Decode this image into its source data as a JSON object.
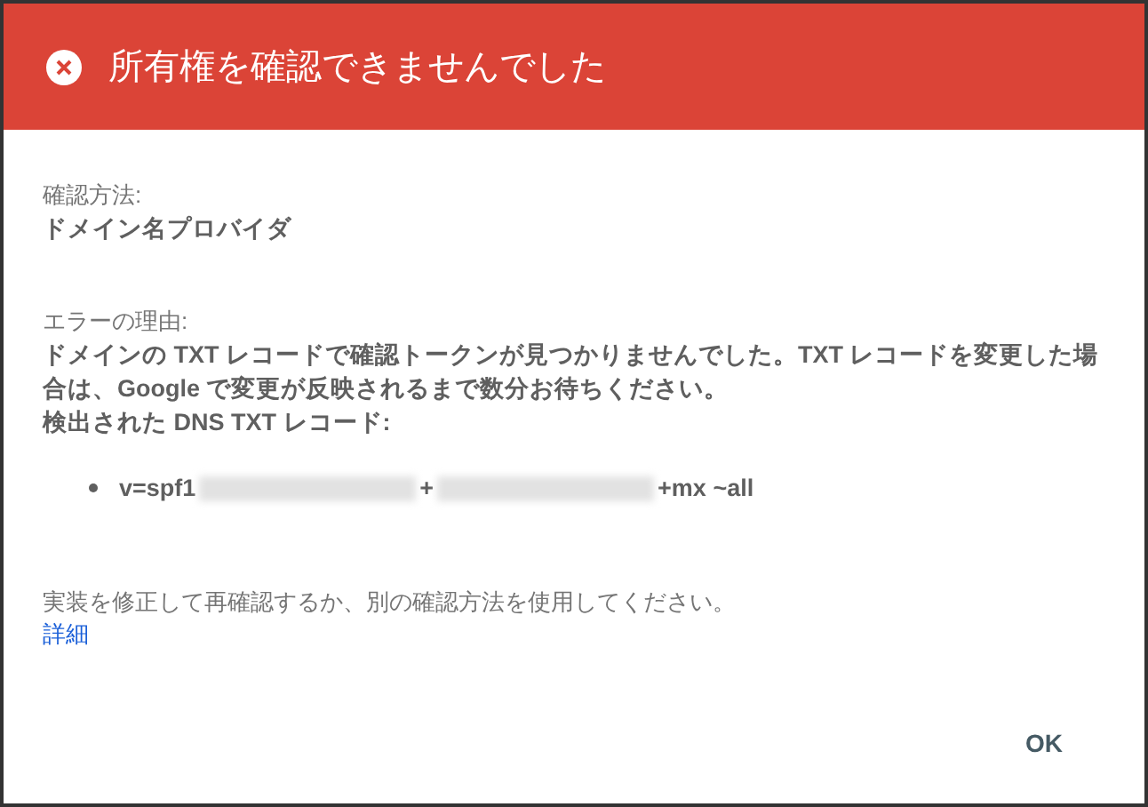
{
  "dialog": {
    "title": "所有権を確認できませんでした",
    "method": {
      "label": "確認方法:",
      "value": "ドメイン名プロバイダ"
    },
    "error": {
      "label": "エラーの理由:",
      "message": "ドメインの TXT レコードで確認トークンが見つかりませんでした。TXT レコードを変更した場合は、Google で変更が反映されるまで数分お待ちください。",
      "records_label": "検出された DNS TXT レコード:",
      "records": [
        {
          "parts": [
            {
              "kind": "text",
              "text": "v=spf1"
            },
            {
              "kind": "redacted"
            },
            {
              "kind": "text",
              "text": "+"
            },
            {
              "kind": "redacted"
            },
            {
              "kind": "text",
              "text": "+mx ~all"
            }
          ]
        }
      ]
    },
    "hint": "実装を修正して再確認するか、別の確認方法を使用してください。",
    "link": "詳細",
    "buttons": [
      "OK"
    ]
  }
}
